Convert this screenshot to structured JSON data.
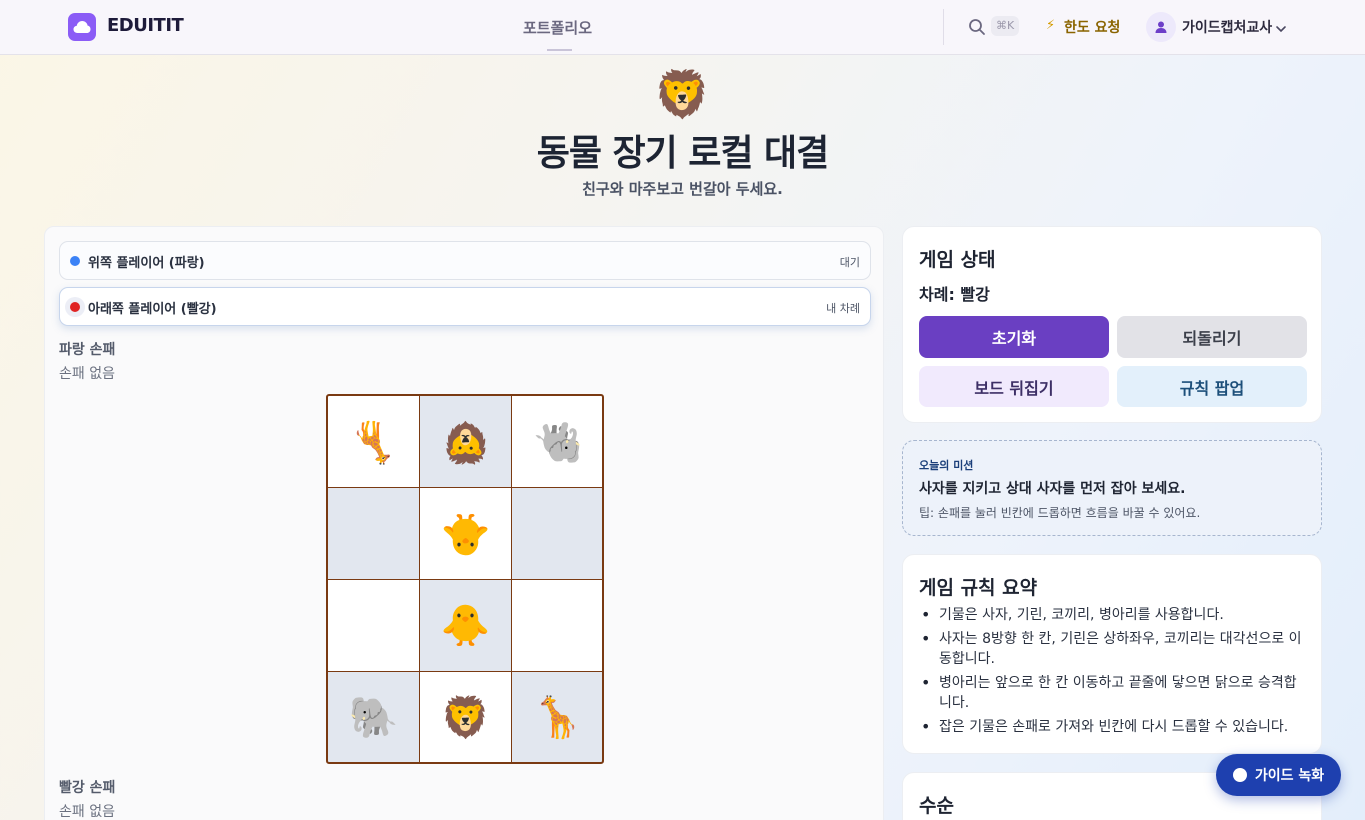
{
  "nav": {
    "logo_text": "EDUITIT",
    "center_link": "포트폴리오",
    "shortcut": "⌘K",
    "quota_label": "한도 요청",
    "user_name": "가이드캡처교사"
  },
  "hero": {
    "emoji": "🦁",
    "title": "동물 장기 로컬 대결",
    "subtitle": "친구와 마주보고 번갈아 두세요."
  },
  "players": {
    "top": {
      "name": "위쪽 플레이어 (파랑)",
      "status": "대기",
      "color": "#3b82f6"
    },
    "bottom": {
      "name": "아래쪽 플레이어 (빨강)",
      "status": "내 차례",
      "color": "#e02424"
    }
  },
  "hands": {
    "blue": {
      "title": "파랑 손패",
      "empty": "손패 없음"
    },
    "red": {
      "title": "빨강 손패",
      "empty": "손패 없음"
    }
  },
  "board": {
    "rows": 4,
    "cols": 3,
    "cells": [
      {
        "piece": "🦒",
        "owner": "blue",
        "shade": "light"
      },
      {
        "piece": "🦁",
        "owner": "blue",
        "shade": "dark"
      },
      {
        "piece": "🐘",
        "owner": "blue",
        "shade": "light"
      },
      {
        "piece": "",
        "owner": "",
        "shade": "dark"
      },
      {
        "piece": "🐥",
        "owner": "blue",
        "shade": "light"
      },
      {
        "piece": "",
        "owner": "",
        "shade": "dark"
      },
      {
        "piece": "",
        "owner": "",
        "shade": "light"
      },
      {
        "piece": "🐥",
        "owner": "red",
        "shade": "dark"
      },
      {
        "piece": "",
        "owner": "",
        "shade": "light"
      },
      {
        "piece": "🐘",
        "owner": "red",
        "shade": "dark"
      },
      {
        "piece": "🦁",
        "owner": "red",
        "shade": "light"
      },
      {
        "piece": "🦒",
        "owner": "red",
        "shade": "dark"
      }
    ]
  },
  "status_card": {
    "title": "게임 상태",
    "turn": "차례: 빨강",
    "buttons": {
      "reset": "초기화",
      "undo": "되돌리기",
      "flip": "보드 뒤집기",
      "rules": "규칙 팝업"
    }
  },
  "mission": {
    "label": "오늘의 미션",
    "text": "사자를 지키고 상대 사자를 먼저 잡아 보세요.",
    "tip": "팁: 손패를 눌러 빈칸에 드롭하면 흐름을 바꿀 수 있어요."
  },
  "rules_card": {
    "title": "게임 규칙 요약",
    "items": [
      "기물은 사자, 기린, 코끼리, 병아리를 사용합니다.",
      "사자는 8방향 한 칸, 기린은 상하좌우, 코끼리는 대각선으로 이동합니다.",
      "병아리는 앞으로 한 칸 이동하고 끝줄에 닿으면 닭으로 승격합니다.",
      "잡은 기물은 손패로 가져와 빈칸에 다시 드롭할 수 있습니다."
    ]
  },
  "moves_card": {
    "title": "수순"
  },
  "record_button": {
    "label": "가이드 녹화"
  }
}
